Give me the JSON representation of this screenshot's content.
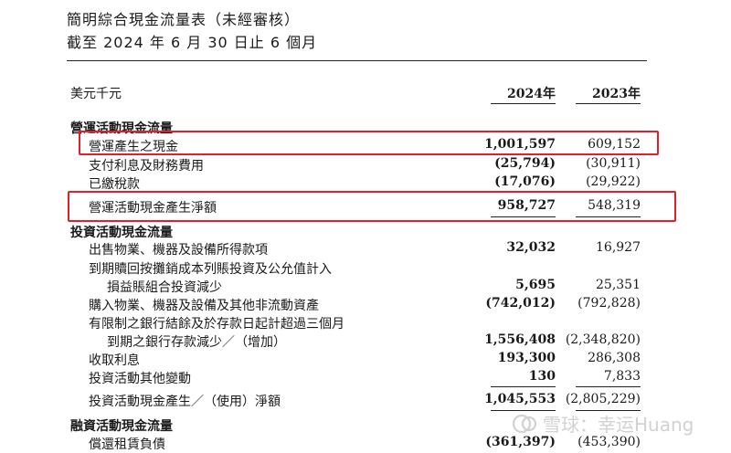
{
  "header": {
    "title": "簡明綜合現金流量表（未經審核）",
    "subtitle": "截至 2024 年 6 月 30 日止 6 個月",
    "currency": "美元千元",
    "col_2024": "2024年",
    "col_2023": "2023年"
  },
  "operating": {
    "title": "營運活動現金流量",
    "rows": [
      {
        "label": "營運產生之現金",
        "v2024": "1,001,597",
        "v2023": "609,152"
      },
      {
        "label": "支付利息及財務費用",
        "v2024": "(25,794)",
        "v2023": "(30,911)"
      },
      {
        "label": "已繳稅款",
        "v2024": "(17,076)",
        "v2023": "(29,922)"
      }
    ],
    "net": {
      "label": "營運活動現金產生淨額",
      "v2024": "958,727",
      "v2023": "548,319"
    }
  },
  "investing": {
    "title": "投資活動現金流量",
    "rows": [
      {
        "label": "出售物業、機器及設備所得款項",
        "v2024": "32,032",
        "v2023": "16,927"
      },
      {
        "label": "到期贖回按攤銷成本列賬投資及公允值計入",
        "v2024": "",
        "v2023": ""
      },
      {
        "label": "損益賬組合投資減少",
        "v2024": "5,695",
        "v2023": "25,351"
      },
      {
        "label": "購入物業、機器及設備及其他非流動資產",
        "v2024": "(742,012)",
        "v2023": "(792,828)"
      },
      {
        "label": "有限制之銀行結餘及於存款日起計超過三個月",
        "v2024": "",
        "v2023": ""
      },
      {
        "label": "到期之銀行存款減少／（增加）",
        "v2024": "1,556,408",
        "v2023": "(2,348,820)"
      },
      {
        "label": "收取利息",
        "v2024": "193,300",
        "v2023": "286,308"
      },
      {
        "label": "投資活動其他變動",
        "v2024": "130",
        "v2023": "7,833"
      }
    ],
    "net": {
      "label": "投資活動現金產生／（使用）淨額",
      "v2024": "1,045,553",
      "v2023": "(2,805,229)"
    }
  },
  "financing": {
    "title": "融資活動現金流量",
    "rows": [
      {
        "label": "償還租賃負債",
        "v2024": "(361,397)",
        "v2023": "(453,390)"
      }
    ]
  },
  "watermark": {
    "text": "雪球：幸运Huang",
    "icon": "snowball-logo-icon"
  },
  "colors": {
    "highlight": "#e41e2b",
    "text": "#1a1a1a",
    "watermark": "#d2d2d2"
  }
}
